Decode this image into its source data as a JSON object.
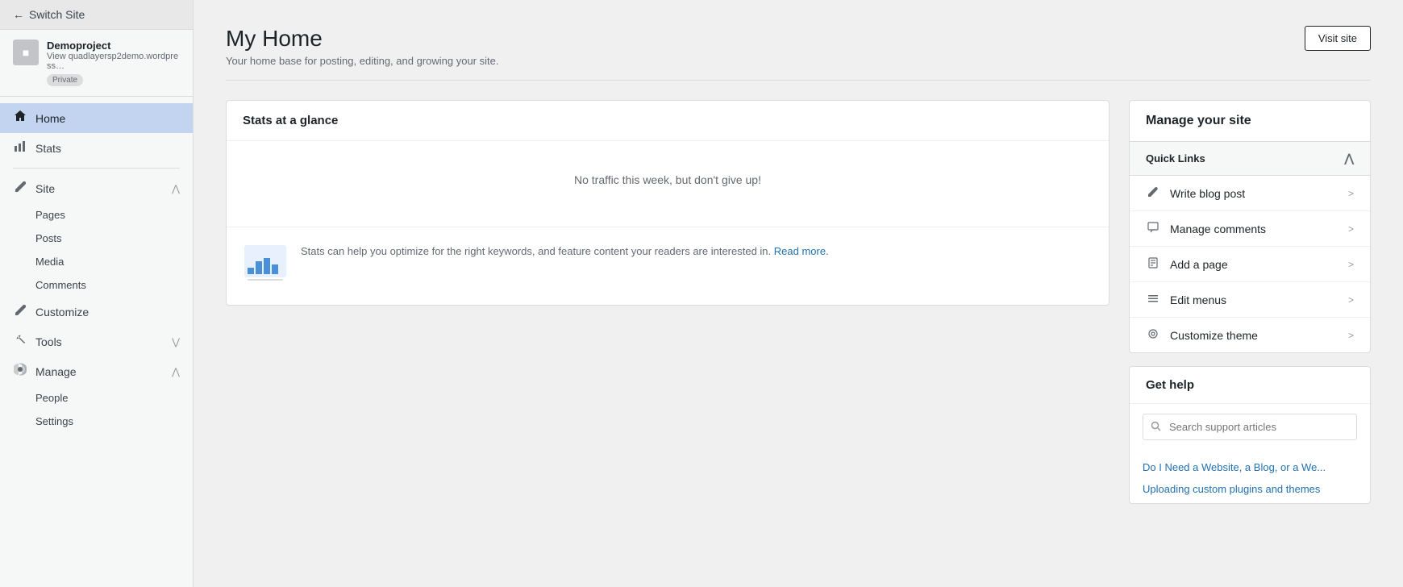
{
  "sidebar": {
    "switch_site_label": "Switch Site",
    "site_name": "Demoproject",
    "site_url": "View quadlayersp2demo.wordpress…",
    "site_badge": "Private",
    "nav_items": [
      {
        "id": "home",
        "label": "Home",
        "icon": "⌂",
        "active": true
      },
      {
        "id": "stats",
        "label": "Stats",
        "icon": "📊",
        "active": false
      },
      {
        "id": "site",
        "label": "Site",
        "icon": "✏",
        "active": false,
        "expanded": true,
        "subitems": [
          "Pages",
          "Posts",
          "Media",
          "Comments"
        ]
      },
      {
        "id": "customize",
        "label": "Customize",
        "icon": "✏",
        "active": false
      },
      {
        "id": "tools",
        "label": "Tools",
        "icon": "🔧",
        "active": false,
        "collapsed": true
      },
      {
        "id": "manage",
        "label": "Manage",
        "icon": "⚙",
        "active": false,
        "expanded": true,
        "subitems": [
          "People",
          "Settings"
        ]
      }
    ]
  },
  "page": {
    "title": "My Home",
    "subtitle": "Your home base for posting, editing, and growing your site.",
    "visit_site_label": "Visit site"
  },
  "stats": {
    "section_title": "Stats at a glance",
    "empty_text": "No traffic this week, but don't give up!",
    "promo_text": "Stats can help you optimize for the right keywords, and feature content your readers are interested in.",
    "promo_link_text": "Read more.",
    "promo_link_url": "#"
  },
  "manage_site": {
    "section_title": "Manage your site",
    "quick_links_label": "Quick Links",
    "quick_links": [
      {
        "id": "write-blog-post",
        "label": "Write blog post",
        "icon": "✏"
      },
      {
        "id": "manage-comments",
        "label": "Manage comments",
        "icon": "▭"
      },
      {
        "id": "add-a-page",
        "label": "Add a page",
        "icon": "📄"
      },
      {
        "id": "edit-menus",
        "label": "Edit menus",
        "icon": "≡"
      },
      {
        "id": "customize-theme",
        "label": "Customize theme",
        "icon": "◎"
      }
    ]
  },
  "help": {
    "section_title": "Get help",
    "search_placeholder": "Search support articles",
    "links": [
      {
        "id": "link1",
        "label": "Do I Need a Website, a Blog, or a We..."
      },
      {
        "id": "link2",
        "label": "Uploading custom plugins and themes"
      }
    ]
  }
}
